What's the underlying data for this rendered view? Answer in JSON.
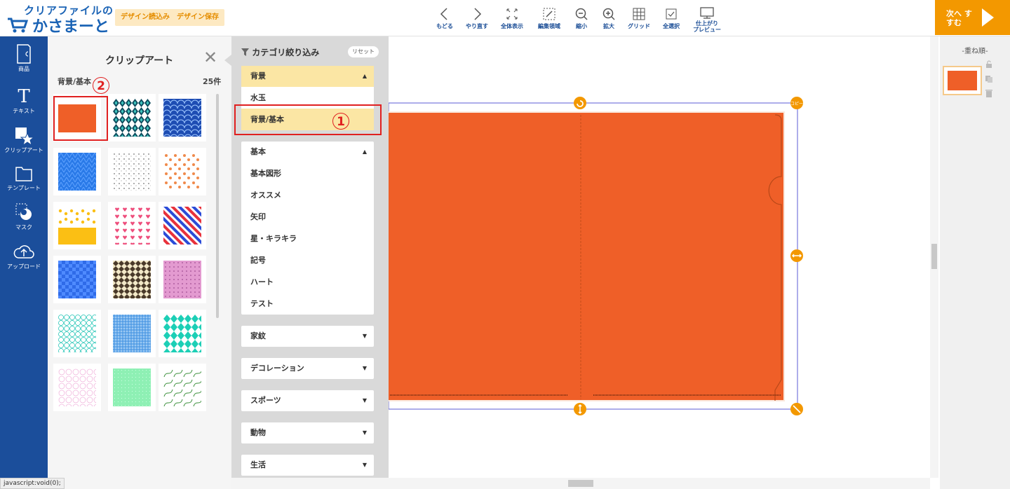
{
  "header": {
    "logo_line1": "クリアファイルの",
    "logo_line2": "かさまーと",
    "load_button": "デザイン読込み",
    "save_button": "デザイン保存",
    "toolbar": [
      {
        "label": "もどる",
        "icon": "chevron-left-icon"
      },
      {
        "label": "やり直す",
        "icon": "chevron-right-icon"
      },
      {
        "label": "全体表示",
        "icon": "expand-icon"
      },
      {
        "label": "編集領域",
        "icon": "edit-area-icon"
      },
      {
        "label": "縮小",
        "icon": "zoom-out-icon"
      },
      {
        "label": "拡大",
        "icon": "zoom-in-icon"
      },
      {
        "label": "グリッド",
        "icon": "grid-icon"
      },
      {
        "label": "全選択",
        "icon": "checkbox-icon"
      },
      {
        "label": "仕上がり",
        "label2": "プレビュー",
        "icon": "monitor-icon"
      }
    ],
    "next_button": "次へ すすむ"
  },
  "leftnav": [
    {
      "label": "商品",
      "icon": "product-icon"
    },
    {
      "label": "テキスト",
      "icon": "text-icon"
    },
    {
      "label": "クリップアート",
      "icon": "clipart-icon"
    },
    {
      "label": "テンプレート",
      "icon": "folder-icon"
    },
    {
      "label": "マスク",
      "icon": "mask-icon"
    },
    {
      "label": "アップロード",
      "icon": "cloud-upload-icon"
    }
  ],
  "clipart": {
    "title": "クリップアート",
    "category": "背景/基本",
    "count": "25件",
    "annotation": "2",
    "tiles": [
      {
        "pattern": "solid-orange"
      },
      {
        "pattern": "diamond-teal"
      },
      {
        "pattern": "scale-blue"
      },
      {
        "pattern": "triangle-blue"
      },
      {
        "pattern": "dots-black"
      },
      {
        "pattern": "paws-orange"
      },
      {
        "pattern": "stars-yellow"
      },
      {
        "pattern": "hearts-pink"
      },
      {
        "pattern": "stripes-tricolor"
      },
      {
        "pattern": "check-blue"
      },
      {
        "pattern": "argyle-brown"
      },
      {
        "pattern": "dots-pink"
      },
      {
        "pattern": "circles-teal"
      },
      {
        "pattern": "plaid-blue"
      },
      {
        "pattern": "diamond-green"
      },
      {
        "pattern": "lace-pink"
      },
      {
        "pattern": "dots-mint"
      },
      {
        "pattern": "vines-green"
      }
    ]
  },
  "categories": {
    "title": "カテゴリ絞り込み",
    "reset": "リセット",
    "annotation": "1",
    "groups": [
      {
        "label": "背景",
        "open": true,
        "items": [
          "水玉",
          "背景/基本"
        ],
        "selected": "背景/基本"
      },
      {
        "label": "基本",
        "open": true,
        "items": [
          "基本図形",
          "オススメ",
          "矢印",
          "星・キラキラ",
          "記号",
          "ハート",
          "テスト"
        ]
      },
      {
        "label": "家紋",
        "open": false
      },
      {
        "label": "デコレーション",
        "open": false
      },
      {
        "label": "スポーツ",
        "open": false
      },
      {
        "label": "動物",
        "open": false
      },
      {
        "label": "生活",
        "open": false
      }
    ]
  },
  "canvas": {
    "copy_handle": "コピー",
    "fill_color": "#ef5f28"
  },
  "layers": {
    "title": "-重ね順-"
  },
  "status_bar": "javascript:void(0);",
  "colors": {
    "brand_blue": "#1b4e9b",
    "accent_orange": "#f39800",
    "highlight": "#fbe6a4",
    "annotation_red": "#e02020"
  }
}
